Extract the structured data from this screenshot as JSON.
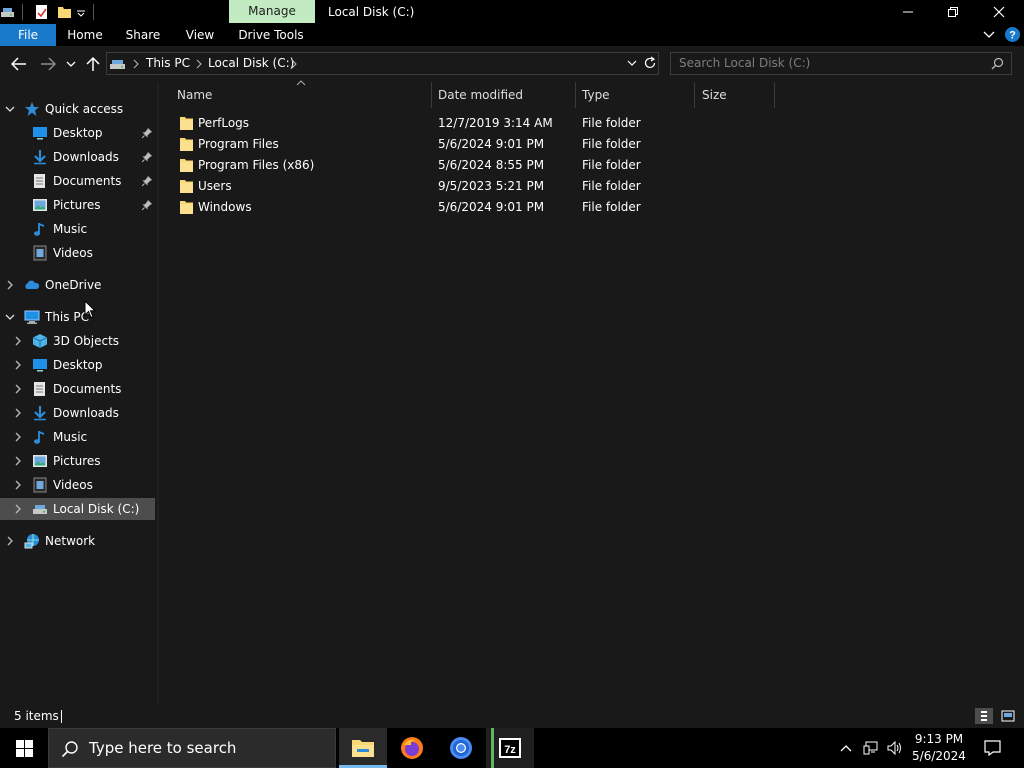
{
  "window": {
    "title": "Local Disk (C:)",
    "context_tab": "Manage",
    "colors": {
      "file_tab": "#1979ca",
      "manage_tab": "#c3ebc2",
      "selection": "#4d4d4d",
      "folder": "#f8d775",
      "accent": "#76b9ed"
    }
  },
  "ribbon": {
    "tabs": [
      "File",
      "Home",
      "Share",
      "View",
      "Drive Tools"
    ]
  },
  "address": {
    "segments": [
      "This PC",
      "Local Disk (C:)"
    ],
    "search_placeholder": "Search Local Disk (C:)"
  },
  "nav": {
    "quick_access": {
      "label": "Quick access",
      "items": [
        {
          "label": "Desktop",
          "icon": "desktop-icon",
          "pinned": true
        },
        {
          "label": "Downloads",
          "icon": "downloads-icon",
          "pinned": true
        },
        {
          "label": "Documents",
          "icon": "documents-icon",
          "pinned": true
        },
        {
          "label": "Pictures",
          "icon": "pictures-icon",
          "pinned": true
        },
        {
          "label": "Music",
          "icon": "music-icon",
          "pinned": false
        },
        {
          "label": "Videos",
          "icon": "videos-icon",
          "pinned": false
        }
      ]
    },
    "onedrive": {
      "label": "OneDrive"
    },
    "this_pc": {
      "label": "This PC",
      "items": [
        {
          "label": "3D Objects",
          "icon": "3d-objects-icon"
        },
        {
          "label": "Desktop",
          "icon": "desktop-icon"
        },
        {
          "label": "Documents",
          "icon": "documents-icon"
        },
        {
          "label": "Downloads",
          "icon": "downloads-icon"
        },
        {
          "label": "Music",
          "icon": "music-icon"
        },
        {
          "label": "Pictures",
          "icon": "pictures-icon"
        },
        {
          "label": "Videos",
          "icon": "videos-icon"
        },
        {
          "label": "Local Disk (C:)",
          "icon": "drive-icon",
          "selected": true
        }
      ]
    },
    "network": {
      "label": "Network"
    }
  },
  "files": {
    "columns": [
      "Name",
      "Date modified",
      "Type",
      "Size"
    ],
    "rows": [
      {
        "name": "PerfLogs",
        "date": "12/7/2019 3:14 AM",
        "type": "File folder",
        "size": ""
      },
      {
        "name": "Program Files",
        "date": "5/6/2024 9:01 PM",
        "type": "File folder",
        "size": ""
      },
      {
        "name": "Program Files (x86)",
        "date": "5/6/2024 8:55 PM",
        "type": "File folder",
        "size": ""
      },
      {
        "name": "Users",
        "date": "9/5/2023 5:21 PM",
        "type": "File folder",
        "size": ""
      },
      {
        "name": "Windows",
        "date": "5/6/2024 9:01 PM",
        "type": "File folder",
        "size": ""
      }
    ]
  },
  "status": {
    "item_count": "5 items"
  },
  "taskbar": {
    "search_placeholder": "Type here to search",
    "apps": [
      "file-explorer-icon",
      "firefox-icon",
      "chrome-icon",
      "7zip-icon"
    ],
    "time": "9:13 PM",
    "date": "5/6/2024"
  }
}
